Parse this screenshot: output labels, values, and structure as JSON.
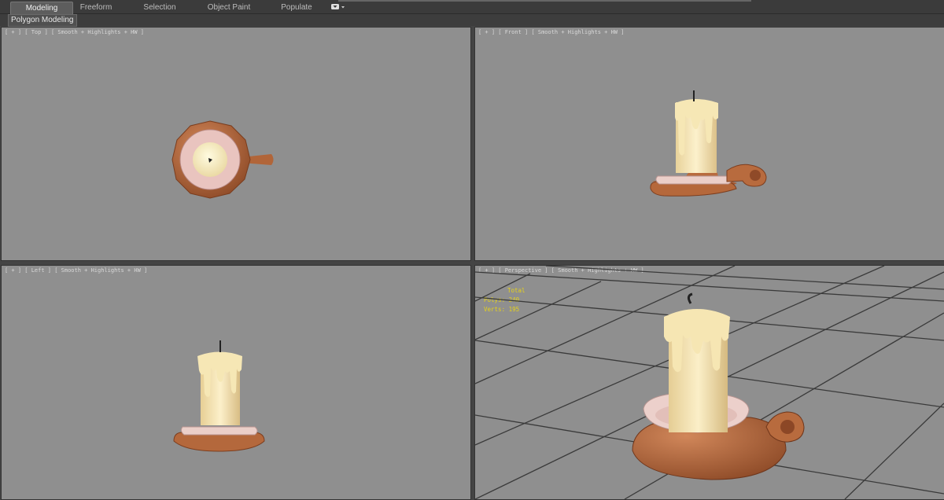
{
  "ribbon": {
    "tabs": [
      {
        "label": "Modeling",
        "active": true
      },
      {
        "label": "Freeform",
        "active": false
      },
      {
        "label": "Selection",
        "active": false
      },
      {
        "label": "Object Paint",
        "active": false
      },
      {
        "label": "Populate",
        "active": false
      }
    ],
    "options_icon": "dropdown-toggle-icon"
  },
  "subbar": {
    "label": "Polygon Modeling"
  },
  "viewports": {
    "top": {
      "label": "[ + ] [ Top ] [ Smooth + Highlights + HW ]"
    },
    "front": {
      "label": "[ + ] [ Front ] [ Smooth + Highlights + HW ]"
    },
    "left": {
      "label": "[ + ] [ Left ] [ Smooth + Highlights + HW ]"
    },
    "perspective": {
      "label": "[ + ] [ Perspective ] [ Smooth + Highlights + HW ]"
    }
  },
  "stats": {
    "title": "Total",
    "polys_label": "Polys:",
    "polys_value": "240",
    "verts_label": "Verts:",
    "verts_value": "195"
  },
  "colors": {
    "viewport_bg": "#8f8f8f",
    "wood": "#b86b3e",
    "saucer": "#e8c6c1",
    "candle": "#f1dfae",
    "stats_text": "#e6d21a"
  }
}
